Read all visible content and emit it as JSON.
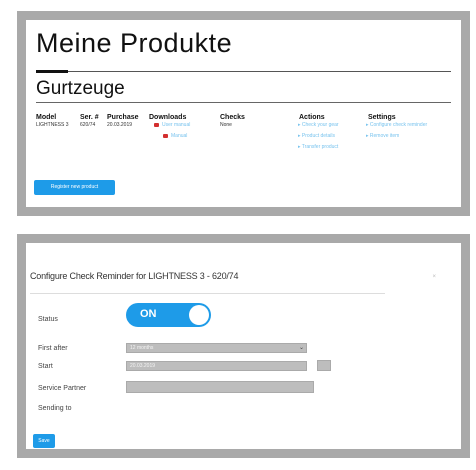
{
  "products": {
    "title": "Meine Produkte",
    "category": "Gurtzeuge",
    "headers": {
      "model": "Model",
      "serial": "Ser. #",
      "purchase": "Purchase",
      "downloads": "Downloads",
      "checks": "Checks",
      "actions": "Actions",
      "settings": "Settings"
    },
    "row": {
      "model": "LIGHTNESS 3",
      "serial": "620/74",
      "purchase": "20.03.2019",
      "check": "None"
    },
    "downloads": [
      "User manual",
      "Manual"
    ],
    "actions": [
      "Check your gear",
      "Product details",
      "Transfer product"
    ],
    "settings": [
      "Configure check reminder",
      "Remove item"
    ],
    "register_button": "Register new product"
  },
  "modal": {
    "title": "Configure Check Reminder for LIGHTNESS 3 - 620/74",
    "close_glyph": "×",
    "labels": {
      "status": "Status",
      "first_after": "First after",
      "start": "Start",
      "service_partner": "Service Partner",
      "sending_to": "Sending to"
    },
    "status_value": "ON",
    "first_after_value": "12 months",
    "start_value": "20.03.2019",
    "save_label": "Save"
  },
  "colors": {
    "accent": "#1e9be8",
    "link": "#78c3ee",
    "pdf": "#d32f2f",
    "frame": "#a9a9a9"
  }
}
